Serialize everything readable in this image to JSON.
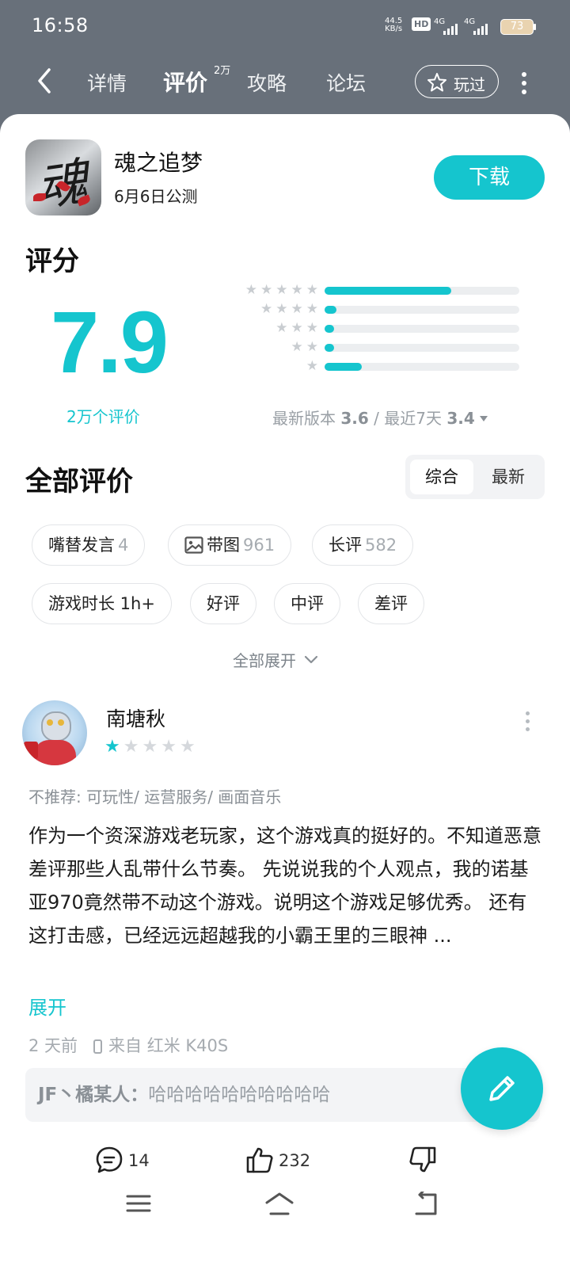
{
  "status_bar": {
    "time": "16:58",
    "net_speed_value": "44.5",
    "net_speed_unit": "KB/s",
    "hd_label": "HD",
    "signal_1": "4G",
    "signal_2": "4G",
    "battery": "73"
  },
  "nav": {
    "tabs": [
      {
        "label": "详情"
      },
      {
        "label": "评价"
      },
      {
        "label": "攻略"
      },
      {
        "label": "论坛"
      }
    ],
    "active_tab": "评价",
    "review_count_sup": "2万",
    "played_label": "玩过"
  },
  "app": {
    "name": "魂之追梦",
    "icon_char": "魂",
    "release_note": "6月6日公测",
    "download_label": "下载"
  },
  "rating": {
    "title": "评分",
    "score": "7.9",
    "count_label": "2万个评价",
    "version_label": "最新版本",
    "version_score": "3.6",
    "separator": "/",
    "recent_label": "最近7天",
    "recent_score": "3.4",
    "distribution": [
      {
        "stars": 5,
        "fraction": 0.65
      },
      {
        "stars": 4,
        "fraction": 0.06
      },
      {
        "stars": 3,
        "fraction": 0.05
      },
      {
        "stars": 2,
        "fraction": 0.05
      },
      {
        "stars": 1,
        "fraction": 0.19
      }
    ]
  },
  "reviews_section": {
    "title": "全部评价",
    "sort_options": [
      "综合",
      "最新"
    ],
    "sort_selected": "综合",
    "filter_chips": [
      {
        "label": "嘴替发言",
        "count": "4"
      },
      {
        "label": "带图",
        "count": "961",
        "icon": "image-icon"
      },
      {
        "label": "长评",
        "count": "582"
      },
      {
        "label": "游戏时长 1h+",
        "count": ""
      },
      {
        "label": "好评",
        "count": ""
      },
      {
        "label": "中评",
        "count": ""
      },
      {
        "label": "差评",
        "count": ""
      }
    ],
    "expand_all_label": "全部展开"
  },
  "review": {
    "username": "南塘秋",
    "rating": 1,
    "max_rating": 5,
    "tags": "不推荐: 可玩性/ 运营服务/ 画面音乐",
    "text": "作为一个资深游戏老玩家，这个游戏真的挺好的。不知道恶意差评那些人乱带什么节奏。 先说说我的个人观点，我的诺基亚970竟然带不动这个游戏。说明这个游戏足够优秀。 还有这打击感，已经远远超越我的小霸王里的三眼神 ...",
    "expand_label": "展开",
    "time_ago": "2 天前",
    "device": "来自 红米 K40S",
    "reply_author": "JF丶橘某人：",
    "reply_text": "哈哈哈哈哈哈哈哈哈哈",
    "comments": "14",
    "likes": "232"
  },
  "colors": {
    "accent": "#15c5ce",
    "header_bg": "#68707a"
  }
}
